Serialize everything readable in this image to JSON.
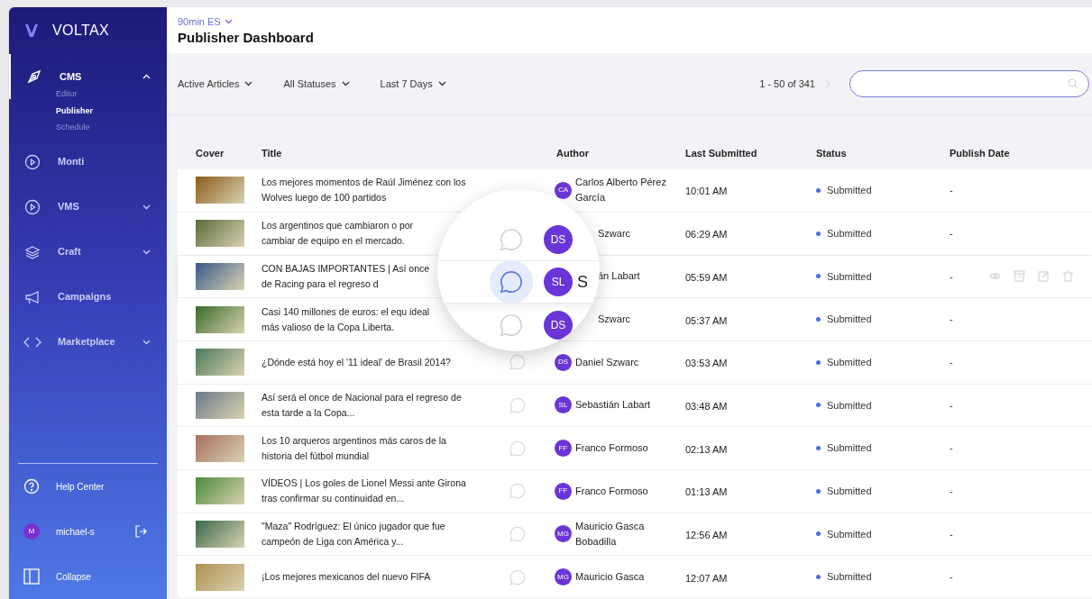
{
  "sidebar": {
    "logo": "VOLTAX",
    "items": [
      {
        "label": "CMS",
        "active": true,
        "expandable": true,
        "expanded": true,
        "children": [
          {
            "label": "Editor",
            "selected": false
          },
          {
            "label": "Publisher",
            "selected": true
          },
          {
            "label": "Schedule",
            "selected": false
          }
        ]
      },
      {
        "label": "Monti",
        "active": false,
        "expandable": false,
        "expanded": false
      },
      {
        "label": "VMS",
        "active": false,
        "expandable": true,
        "expanded": false
      },
      {
        "label": "Craft",
        "active": false,
        "expandable": true,
        "expanded": false
      },
      {
        "label": "Campaigns",
        "active": false,
        "expandable": false,
        "expanded": false
      },
      {
        "label": "Marketplace",
        "active": false,
        "expandable": true,
        "expanded": false
      }
    ],
    "help": "Help Center",
    "user": {
      "initial": "M",
      "name": "michael-s"
    },
    "collapse": "Collapse"
  },
  "header": {
    "site": "90min ES",
    "title": "Publisher Dashboard"
  },
  "filters": [
    "Active Articles",
    "All Statuses",
    "Last 7 Days"
  ],
  "pagination": "1 - 50 of 341",
  "table": {
    "columns": [
      "Cover",
      "Title",
      "Author",
      "Last Submitted",
      "Status",
      "Publish Date"
    ],
    "rows": [
      {
        "title": "Los mejores momentos de Raúl Jiménez con los Wolves luego de 100 partidos",
        "initials": "CA",
        "comment": false,
        "author": "Carlos Alberto Pérez García",
        "time": "10:01 AM",
        "status": "Submitted",
        "publish": "-",
        "hovered": false,
        "in_lens": false
      },
      {
        "title": "Los argentinos que cambiaron o por cambiar de equipo en el mercado.",
        "initials": "DS",
        "comment": true,
        "author": "Szwarc",
        "time": "06:29 AM",
        "status": "Submitted",
        "publish": "-",
        "hovered": false,
        "in_lens": true
      },
      {
        "title": "CON BAJAS IMPORTANTES | Así once de Racing para el regreso d",
        "initials": "SL",
        "comment": true,
        "author": "án Labart",
        "time": "05:59 AM",
        "status": "Submitted",
        "publish": "-",
        "hovered": true,
        "in_lens": true
      },
      {
        "title": "Casi 140 millones de euros: el equ ideal más valioso de la Copa Liberta.",
        "initials": "DS",
        "comment": true,
        "author": "Szwarc",
        "time": "05:37 AM",
        "status": "Submitted",
        "publish": "-",
        "hovered": false,
        "in_lens": true
      },
      {
        "title": "¿Dónde está hoy el '11 ideal' de Brasil 2014?",
        "initials": "DS",
        "comment": true,
        "author": "Daniel Szwarc",
        "time": "03:53 AM",
        "status": "Submitted",
        "publish": "-",
        "hovered": false,
        "in_lens": false
      },
      {
        "title": "Así será el once de Nacional para el regreso de esta tarde a la Copa...",
        "initials": "SL",
        "comment": true,
        "author": "Sebastián Labart",
        "time": "03:48 AM",
        "status": "Submitted",
        "publish": "-",
        "hovered": false,
        "in_lens": false
      },
      {
        "title": "Los 10 arqueros argentinos más caros de la historia del fútbol mundial",
        "initials": "FF",
        "comment": true,
        "author": "Franco Formoso",
        "time": "02:13 AM",
        "status": "Submitted",
        "publish": "-",
        "hovered": false,
        "in_lens": false
      },
      {
        "title": "VÍDEOS | Los goles de Lionel Messi ante Girona tras confirmar su continuidad en...",
        "initials": "FF",
        "comment": true,
        "author": "Franco Formoso",
        "time": "01:13 AM",
        "status": "Submitted",
        "publish": "-",
        "hovered": false,
        "in_lens": false
      },
      {
        "title": "\"Maza\" Rodríguez: El único jugador que fue campeón de Liga con América y...",
        "initials": "MG",
        "comment": true,
        "author": "Mauricio Gasca Bobadilla",
        "time": "12:56 AM",
        "status": "Submitted",
        "publish": "-",
        "hovered": false,
        "in_lens": false
      },
      {
        "title": "¡Los mejores mexicanos del nuevo FIFA",
        "initials": "MG",
        "comment": true,
        "author": "Mauricio Gasca",
        "time": "12:07 AM",
        "status": "Submitted",
        "publish": "-",
        "hovered": false,
        "in_lens": false
      }
    ]
  },
  "lens": {
    "letter": "S"
  }
}
